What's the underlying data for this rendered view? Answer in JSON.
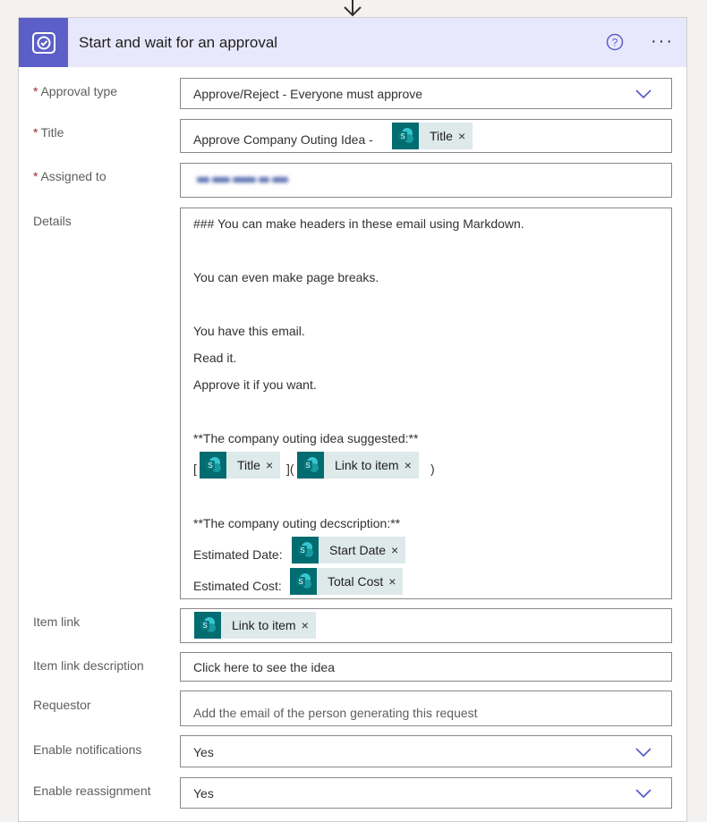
{
  "header": {
    "title": "Start and wait for an approval",
    "icon": "approval-icon",
    "accent": "#5b5fc7"
  },
  "fields": {
    "approval_type": {
      "label": "Approval type",
      "required": "*",
      "value": "Approve/Reject - Everyone must approve"
    },
    "title": {
      "label": "Title",
      "required": "*",
      "prefix": "Approve Company Outing Idea -",
      "token": "Title"
    },
    "assigned_to": {
      "label": "Assigned to",
      "required": "*"
    },
    "details": {
      "label": "Details",
      "lines": [
        "### You can make headers in these email using Markdown.",
        "You can even make page breaks.",
        "You have this email.",
        "Read it.",
        "Approve it if you want.",
        "**The company outing idea suggested:**",
        "**The company outing decscription:**"
      ],
      "link_open": "[",
      "link_mid": "](",
      "link_close": ")",
      "token_title": "Title",
      "token_link": "Link to item",
      "date_label": "Estimated Date:",
      "token_date": "Start Date",
      "cost_label": "Estimated Cost:",
      "token_cost": "Total Cost"
    },
    "item_link": {
      "label": "Item link",
      "token": "Link to item"
    },
    "item_link_description": {
      "label": "Item link description",
      "value": "Click here to see the idea"
    },
    "requestor": {
      "label": "Requestor",
      "placeholder": "Add the email of the person generating this request"
    },
    "enable_notifications": {
      "label": "Enable notifications",
      "value": "Yes"
    },
    "enable_reassignment": {
      "label": "Enable reassignment",
      "value": "Yes"
    }
  },
  "token_remove_glyph": "×",
  "more_glyph": "···"
}
